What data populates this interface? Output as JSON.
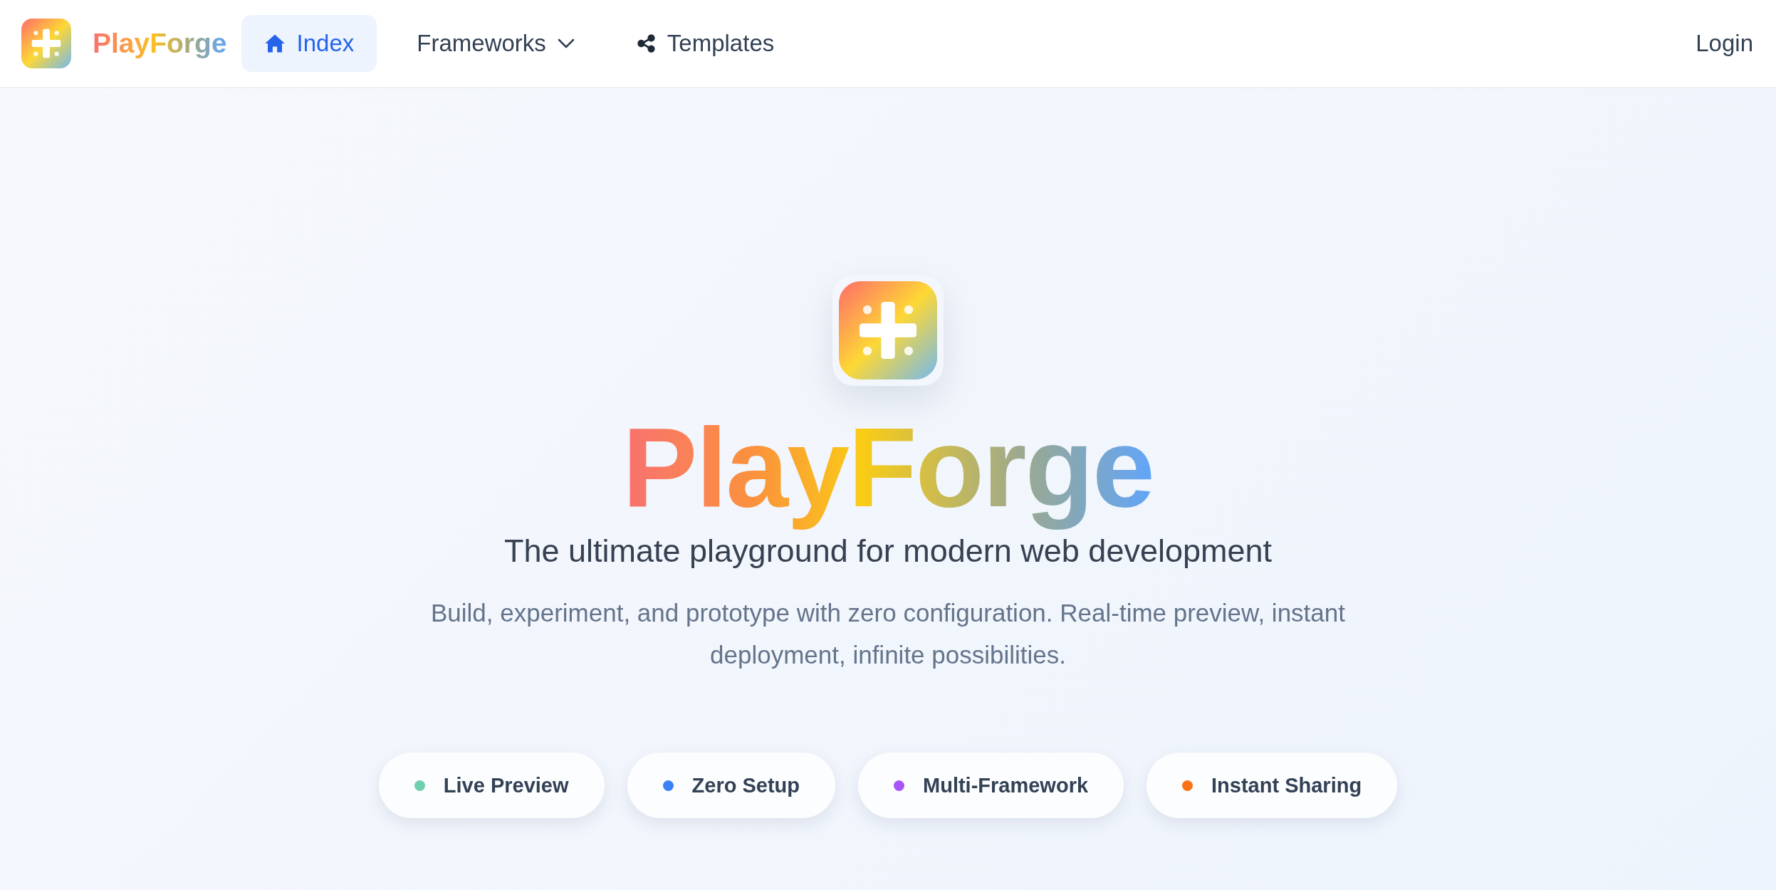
{
  "brand": {
    "name": "PlayForge"
  },
  "nav": [
    {
      "label": "Index",
      "kind": "home",
      "selected": true
    },
    {
      "label": "Frameworks",
      "kind": "dropdown",
      "selected": false
    },
    {
      "label": "Templates",
      "kind": "share",
      "selected": false
    }
  ],
  "login": "Login",
  "hero": {
    "title": "PlayForge",
    "subtitle": "The ultimate playground for modern web development",
    "description": "Build, experiment, and prototype with zero configuration. Real-time preview, instant deployment, infinite possibilities."
  },
  "features": [
    {
      "label": "Live Preview",
      "color": "#6ecfae"
    },
    {
      "label": "Zero Setup",
      "color": "#3b82f6"
    },
    {
      "label": "Multi-Framework",
      "color": "#a855f7"
    },
    {
      "label": "Instant Sharing",
      "color": "#f97316"
    }
  ]
}
